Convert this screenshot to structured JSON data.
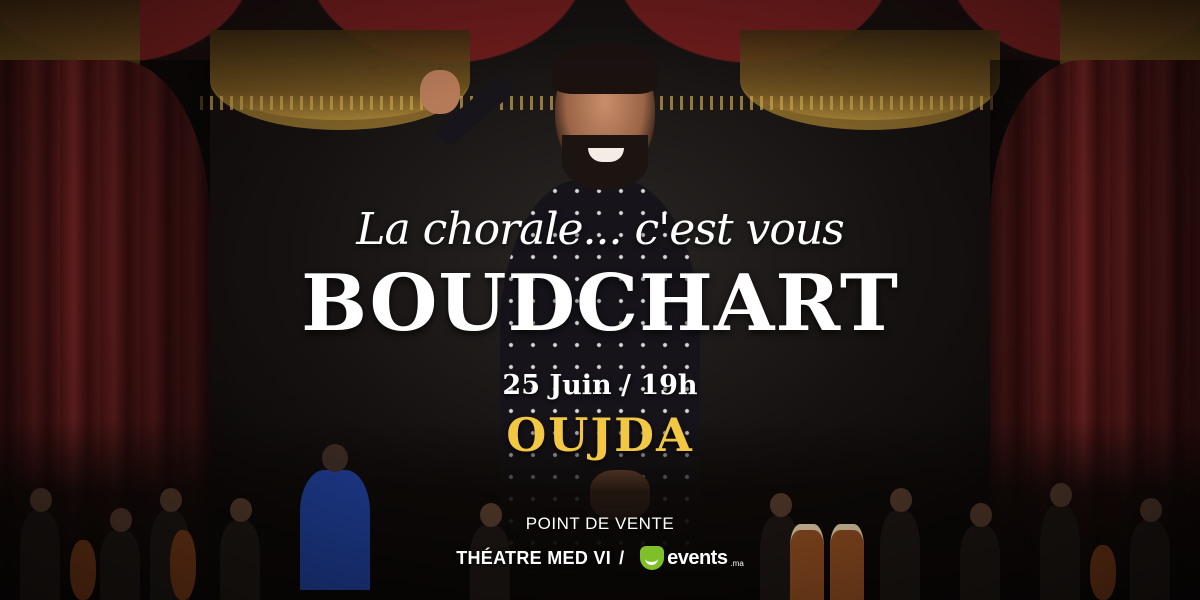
{
  "poster": {
    "tagline": "La chorale... c'est vous",
    "artist": "BOUDCHART",
    "date_time": "25 Juin / 19h",
    "city": "OUJDA",
    "point_of_sale_label": "POINT DE VENTE",
    "venue": "THÉATRE MED VI",
    "separator": "/",
    "brand_name": "events",
    "brand_suffix": ".ma",
    "brand_icon": "events-logo-icon"
  },
  "colors": {
    "city": "#f2c744",
    "curtain": "#7d2323",
    "brand_green": "#7fbf2a",
    "text": "#ffffff"
  }
}
